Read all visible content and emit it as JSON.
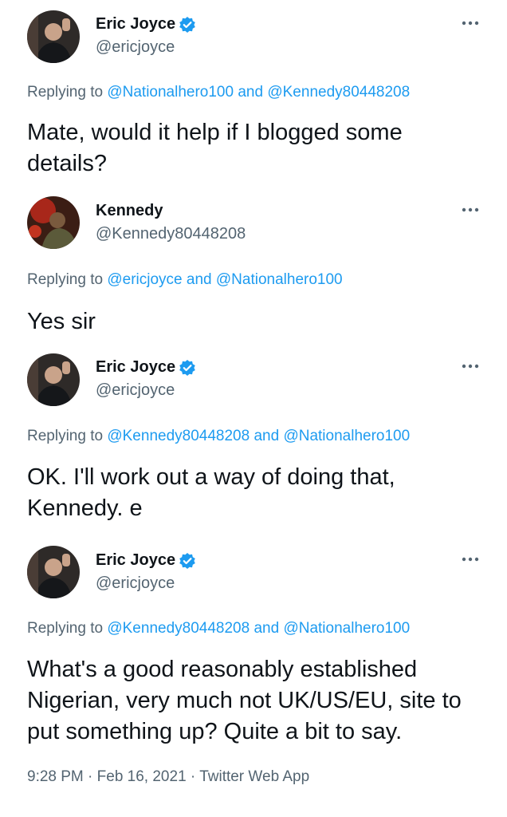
{
  "tweets": [
    {
      "name": "Eric Joyce",
      "handle": "@ericjoyce",
      "verified": true,
      "avatar": "eric-avatar",
      "reply_prefix": "Replying to",
      "reply_a": "@Nationalhero100",
      "reply_and": "and",
      "reply_b": "@Kennedy80448208",
      "text": "Mate, would it help if I blogged some details?"
    },
    {
      "name": "Kennedy",
      "handle": "@Kennedy80448208",
      "verified": false,
      "avatar": "kennedy-avatar",
      "reply_prefix": "Replying to",
      "reply_a": "@ericjoyce",
      "reply_and": "and",
      "reply_b": "@Nationalhero100",
      "text": "Yes sir"
    },
    {
      "name": "Eric Joyce",
      "handle": "@ericjoyce",
      "verified": true,
      "avatar": "eric-avatar",
      "reply_prefix": "Replying to",
      "reply_a": "@Kennedy80448208",
      "reply_and": "and",
      "reply_b": "@Nationalhero100",
      "text": "OK. I'll work out a way of doing that, Kennedy. e"
    },
    {
      "name": "Eric Joyce",
      "handle": "@ericjoyce",
      "verified": true,
      "avatar": "eric-avatar",
      "reply_prefix": "Replying to",
      "reply_a": "@Kennedy80448208",
      "reply_and": "and",
      "reply_b": "@Nationalhero100",
      "text": "What's a good reasonably established Nigerian, very much not UK/US/EU, site to put something up? Quite a bit to say."
    }
  ],
  "footer": {
    "time": "9:28 PM",
    "date": "Feb 16, 2021",
    "source": "Twitter Web App",
    "separator": "·"
  },
  "colors": {
    "link": "#1d9bf0",
    "secondary": "#536471",
    "primary": "#0f1419",
    "verified": "#1d9bf0"
  },
  "icons": {
    "verified": "verified-badge-icon",
    "more": "more-options-icon"
  }
}
